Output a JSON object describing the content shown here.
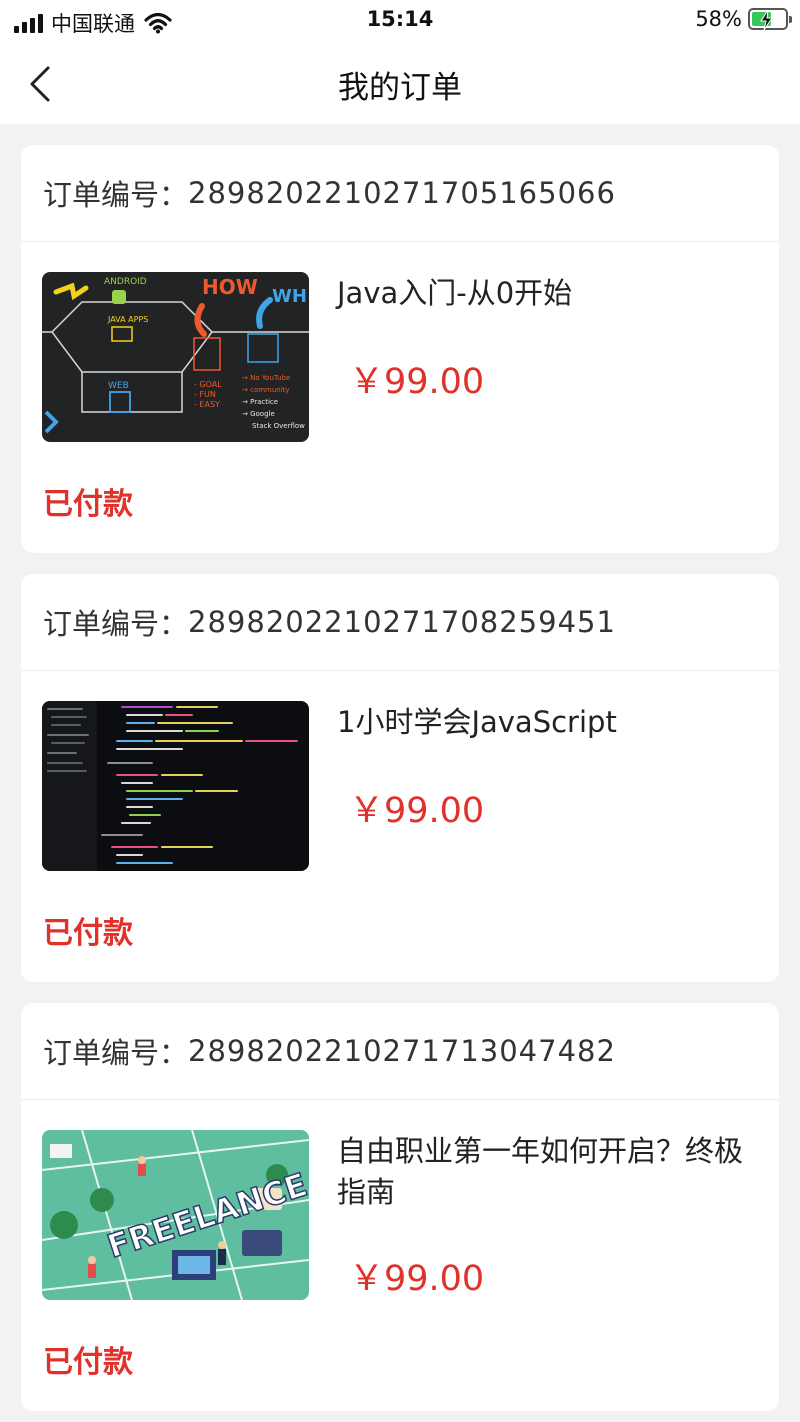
{
  "status_bar": {
    "carrier": "中国联通",
    "time": "15:14",
    "battery_percent": "58%",
    "battery_level": 0.58
  },
  "nav": {
    "title": "我的订单",
    "back_icon": "chevron-left-icon"
  },
  "orders": [
    {
      "number_label": "订单编号：",
      "number": "2898202210271705165066",
      "course_title": "Java入门-从0开始",
      "price": "￥99.00",
      "status": "已付款",
      "thumbnail": "java-chalkboard-diagram"
    },
    {
      "number_label": "订单编号：",
      "number": "2898202210271708259451",
      "course_title": "1小时学会JavaScript",
      "price": "￥99.00",
      "status": "已付款",
      "thumbnail": "code-editor-screenshot"
    },
    {
      "number_label": "订单编号：",
      "number": "2898202210271713047482",
      "course_title": "自由职业第一年如何开启？终极指南",
      "price": "￥99.00",
      "status": "已付款",
      "thumbnail": "freelance-illustration"
    }
  ],
  "colors": {
    "accent_red": "#e0312b",
    "background": "#f2f2f2",
    "card": "#ffffff"
  }
}
